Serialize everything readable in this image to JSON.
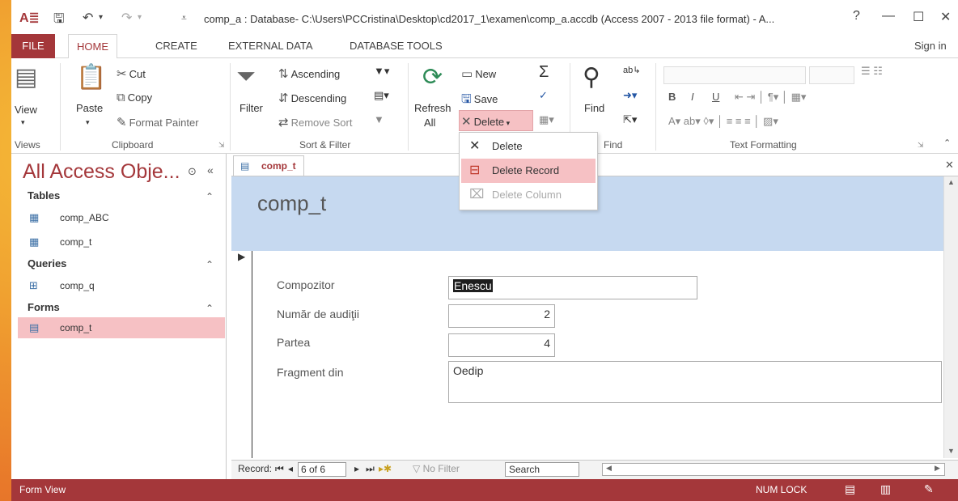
{
  "window": {
    "title": "comp_a : Database- C:\\Users\\PCCristina\\Desktop\\cd2017_1\\examen\\comp_a.accdb (Access 2007 - 2013 file format) - A...",
    "help": "?",
    "minimize": "—",
    "restore": "☐",
    "close": "✕"
  },
  "tabs": {
    "file": "FILE",
    "home": "HOME",
    "create": "CREATE",
    "external": "EXTERNAL DATA",
    "dbtools": "DATABASE TOOLS",
    "signin": "Sign in"
  },
  "ribbon": {
    "views": {
      "view": "View",
      "group": "Views"
    },
    "clipboard": {
      "paste": "Paste",
      "cut": "Cut",
      "copy": "Copy",
      "format_painter": "Format Painter",
      "group": "Clipboard"
    },
    "sort": {
      "filter": "Filter",
      "ascending": "Ascending",
      "descending": "Descending",
      "remove_sort": "Remove Sort",
      "group": "Sort & Filter"
    },
    "records": {
      "refresh": "Refresh",
      "refresh_all": "All",
      "new": "New",
      "save": "Save",
      "delete": "Delete"
    },
    "find": {
      "find": "Find",
      "group": "Find"
    },
    "text": {
      "group": "Text Formatting",
      "bold": "B",
      "italic": "I",
      "underline": "U"
    }
  },
  "delete_menu": [
    {
      "label": "Delete",
      "icon": "x-icon"
    },
    {
      "label": "Delete Record",
      "icon": "delete-record-icon"
    },
    {
      "label": "Delete Column",
      "icon": "delete-column-icon"
    }
  ],
  "nav": {
    "title": "All Access Obje...",
    "tables_header": "Tables",
    "tables": [
      "comp_ABC",
      "comp_t"
    ],
    "queries_header": "Queries",
    "queries": [
      "comp_q"
    ],
    "forms_header": "Forms",
    "forms": [
      "comp_t"
    ]
  },
  "document": {
    "tab_label": "comp_t",
    "form_title": "comp_t",
    "fields": [
      {
        "label": "Compozitor",
        "value": "Enescu"
      },
      {
        "label": "Număr de audiţii",
        "value": "2"
      },
      {
        "label": "Partea",
        "value": "4"
      },
      {
        "label": "Fragment din",
        "value": "Oedip"
      }
    ],
    "record_label": "Record:",
    "record_position": "6 of 6",
    "no_filter": "No Filter",
    "search_placeholder": "Search"
  },
  "status": {
    "left": "Form View",
    "numlock": "NUM LOCK"
  },
  "colors": {
    "accent": "#a4373a",
    "form_header": "#c6d9f0",
    "selection": "#f6c1c4"
  }
}
